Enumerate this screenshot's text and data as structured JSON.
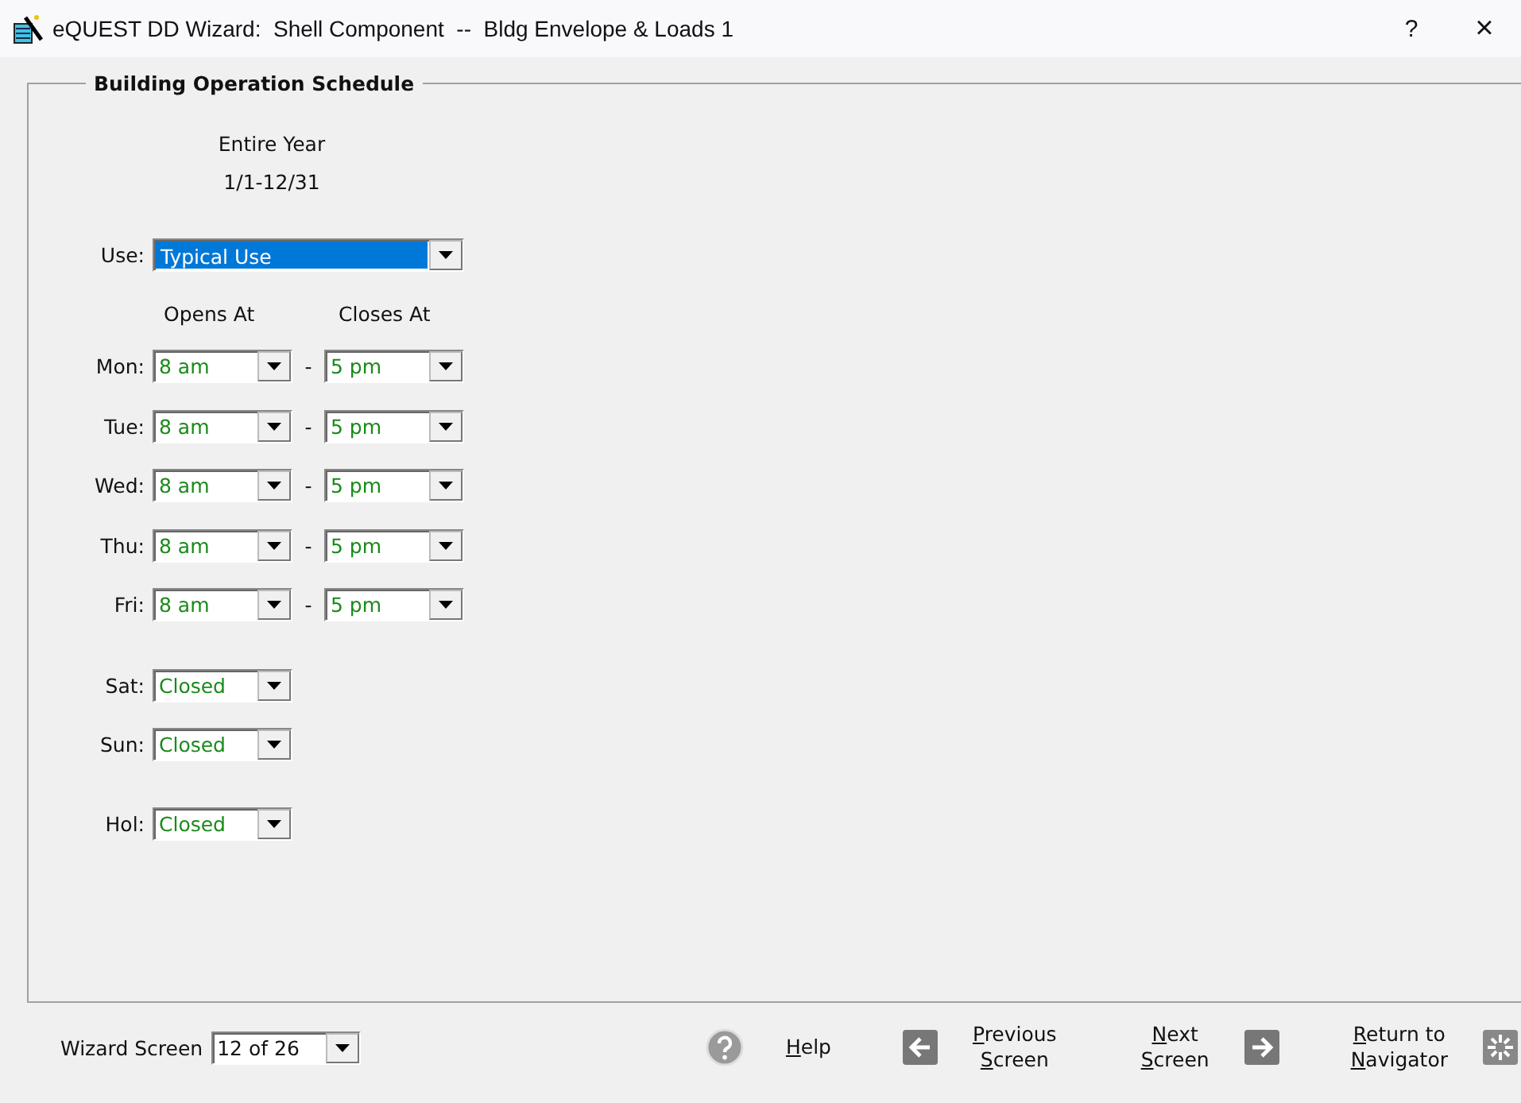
{
  "window": {
    "title": "eQUEST DD Wizard:  Shell Component  --  Bldg Envelope & Loads 1",
    "help": "?",
    "close": "×"
  },
  "group": {
    "title": "Building Operation Schedule",
    "period_title": "Entire Year",
    "period_range": "1/1-12/31"
  },
  "use": {
    "label": "Use:",
    "value": "Typical Use",
    "focused": true
  },
  "headers": {
    "opens": "Opens At",
    "closes": "Closes At"
  },
  "days": [
    {
      "kind": "weekday",
      "label": "Mon:",
      "opens": "8 am",
      "separator": "-",
      "closes": "5 pm"
    },
    {
      "kind": "weekday",
      "label": "Tue:",
      "opens": "8 am",
      "separator": "-",
      "closes": "5 pm"
    },
    {
      "kind": "weekday",
      "label": "Wed:",
      "opens": "8 am",
      "separator": "-",
      "closes": "5 pm"
    },
    {
      "kind": "weekday",
      "label": "Thu:",
      "opens": "8 am",
      "separator": "-",
      "closes": "5 pm"
    },
    {
      "kind": "weekday",
      "label": "Fri:",
      "opens": "8 am",
      "separator": "-",
      "closes": "5 pm"
    },
    {
      "kind": "single",
      "label": "Sat:",
      "value": "Closed"
    },
    {
      "kind": "single",
      "label": "Sun:",
      "value": "Closed"
    },
    {
      "kind": "holiday",
      "label": "Hol:",
      "value": "Closed"
    }
  ],
  "footer": {
    "wizard_label": "Wizard Screen",
    "wizard_value": "12 of 26",
    "buttons": [
      {
        "kind": "help",
        "lines": [
          "Help"
        ],
        "underline_first": true
      },
      {
        "kind": "previous",
        "lines": [
          "Previous",
          "Screen"
        ],
        "underline_first": true
      },
      {
        "kind": "next",
        "lines": [
          "Next",
          "Screen"
        ],
        "underline_first": true
      },
      {
        "kind": "navigator",
        "lines": [
          "Return to",
          "Navigator"
        ],
        "underline_first": true
      }
    ]
  }
}
